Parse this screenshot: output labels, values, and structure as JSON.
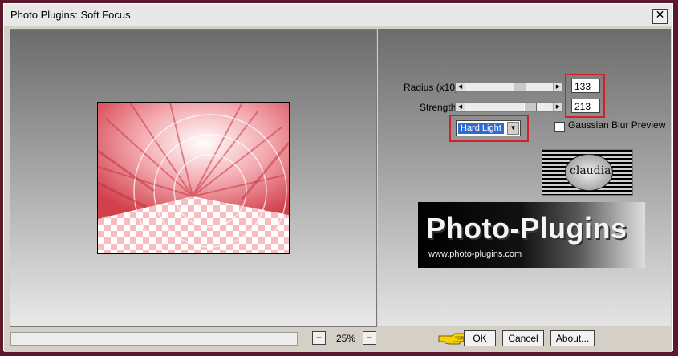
{
  "window": {
    "title": "Photo Plugins: Soft Focus"
  },
  "controls": {
    "radius": {
      "label": "Radius (x10)",
      "value": "133"
    },
    "strength": {
      "label": "Strength",
      "value": "213"
    },
    "mode": {
      "selected": "Hard Light"
    },
    "gaussian_preview": {
      "label": "Gaussian Blur Preview",
      "checked": false
    }
  },
  "logo": {
    "title": "Photo-Plugins",
    "url": "www.photo-plugins.com"
  },
  "stamp": {
    "text": "claudia"
  },
  "bottom": {
    "zoom": "25%",
    "ok_label": "OK",
    "cancel_label": "Cancel",
    "about_label": "About..."
  },
  "colors": {
    "highlight": "#d21f2a",
    "select_blue": "#2f6ad0"
  }
}
